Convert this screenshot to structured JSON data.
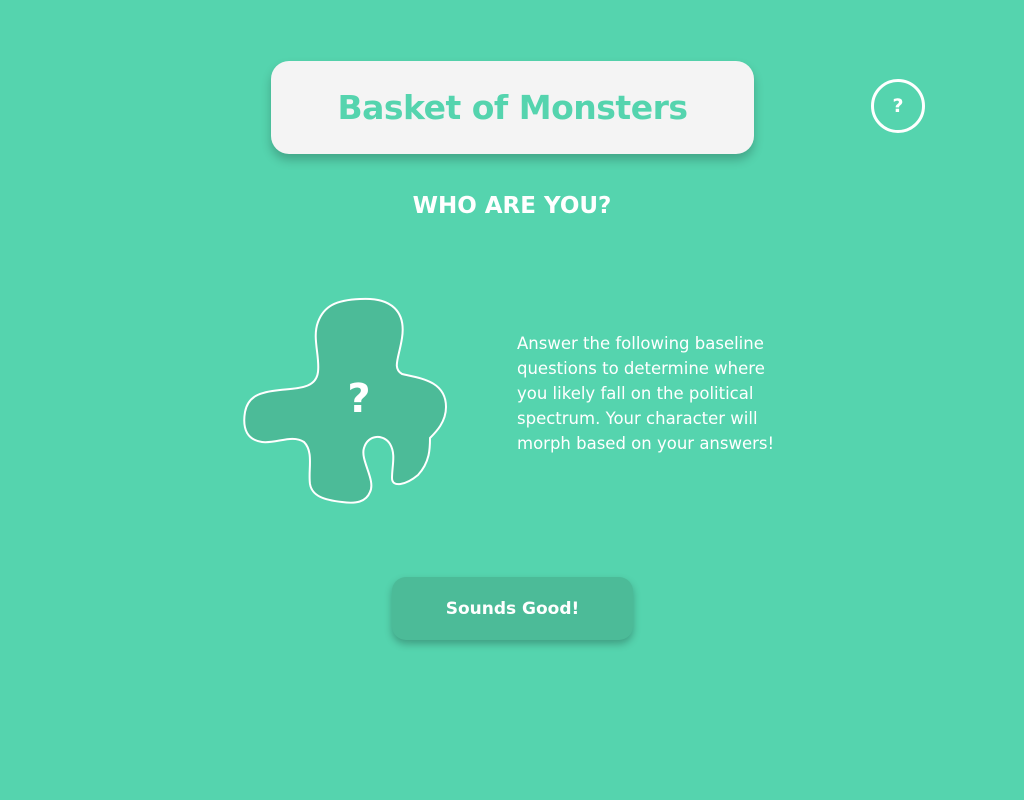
{
  "app": {
    "title": "Basket of Monsters",
    "help_label": "?"
  },
  "intro": {
    "heading": "WHO ARE YOU?",
    "placeholder_mark": "?",
    "description": "Answer the following baseline\nquestions to determine where\nyou likely fall on the political\nspectrum.  Your character will\nmorph based on your answers!",
    "confirm_label": "Sounds Good!"
  },
  "colors": {
    "background": "#55d4ae",
    "card": "#f4f4f4",
    "accent": "#55d4ae",
    "button": "#4cbb98",
    "text": "#ffffff"
  },
  "icons": {
    "help": "question-circle-icon",
    "character": "mystery-monster-blob"
  }
}
